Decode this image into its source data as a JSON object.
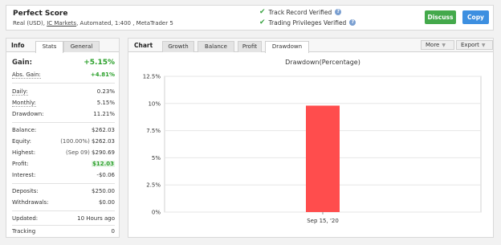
{
  "header": {
    "account_name": "Perfect Score",
    "info_prefix": "Real (USD), ",
    "broker": "IC Markets",
    "info_suffix": ", Automated, 1:400 , MetaTrader 5",
    "verify_track": "Track Record Verified",
    "verify_privileges": "Trading Privileges Verified",
    "discuss_label": "Discuss",
    "copy_label": "Copy"
  },
  "info_panel": {
    "title": "Info",
    "tabs": [
      "Stats",
      "General"
    ],
    "gain_label": "Gain:",
    "gain_value": "+5.15%",
    "abs_gain_label": "Abs. Gain:",
    "abs_gain_value": "+4.81%",
    "daily_label": "Daily:",
    "daily_value": "0.23%",
    "monthly_label": "Monthly:",
    "monthly_value": "5.15%",
    "drawdown_label": "Drawdown:",
    "drawdown_value": "11.21%",
    "balance_label": "Balance:",
    "balance_value": "$262.03",
    "equity_label": "Equity:",
    "equity_pct": "(100.00%)",
    "equity_value": "$262.03",
    "highest_label": "Highest:",
    "highest_date": "(Sep 09)",
    "highest_value": "$290.69",
    "profit_label": "Profit:",
    "profit_value": "$12.03",
    "interest_label": "Interest:",
    "interest_value": "-$0.06",
    "deposits_label": "Deposits:",
    "deposits_value": "$250.00",
    "withdrawals_label": "Withdrawals:",
    "withdrawals_value": "$0.00",
    "updated_label": "Updated:",
    "updated_value": "10 Hours ago",
    "tracking_label": "Tracking",
    "tracking_value": "0"
  },
  "chart_panel": {
    "title": "Chart",
    "tabs": [
      "Growth",
      "Balance",
      "Profit",
      "Drawdown"
    ],
    "active_tab": "Drawdown",
    "more_label": "More",
    "export_label": "Export"
  },
  "chart_data": {
    "type": "bar",
    "title": "Drawdown(Percentage)",
    "categories": [
      "Sep 15, '20"
    ],
    "values": [
      9.8
    ],
    "ylim": [
      0,
      12.5
    ],
    "yticks": [
      0,
      2.5,
      5,
      7.5,
      10,
      12.5
    ],
    "ytick_labels": [
      "0%",
      "2.5%",
      "5%",
      "7.5%",
      "10%",
      "12.5%"
    ],
    "bar_color": "#ff4d4d",
    "grid": true
  }
}
